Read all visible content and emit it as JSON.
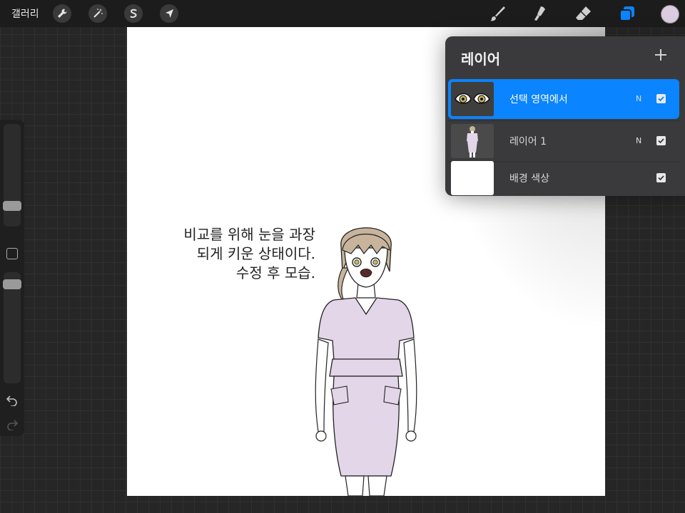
{
  "topbar": {
    "gallery_label": "갤러리",
    "left_tools": [
      "wrench-icon",
      "magic-wand-icon",
      "selection-s-icon",
      "transform-arrow-icon"
    ],
    "right_tools": [
      "brush-icon",
      "smudge-icon",
      "eraser-icon",
      "layers-icon"
    ],
    "active_color": "#dccce0"
  },
  "canvas": {
    "caption_lines": [
      "비교를 위해 눈을 과장",
      "되게 키운 상태이다.",
      "수정 후 모습."
    ]
  },
  "layers": {
    "title": "레이어",
    "add_icon": "plus-icon",
    "items": [
      {
        "name": "선택 영역에서",
        "blend": "N",
        "visible": true,
        "active": true
      },
      {
        "name": "레이어 1",
        "blend": "N",
        "visible": true,
        "active": false
      },
      {
        "name": "배경 색상",
        "blend": "",
        "visible": true,
        "active": false
      }
    ]
  },
  "colors": {
    "accent": "#0a84ff",
    "dress": "#e3d6e8",
    "hair": "#c8b49c"
  }
}
